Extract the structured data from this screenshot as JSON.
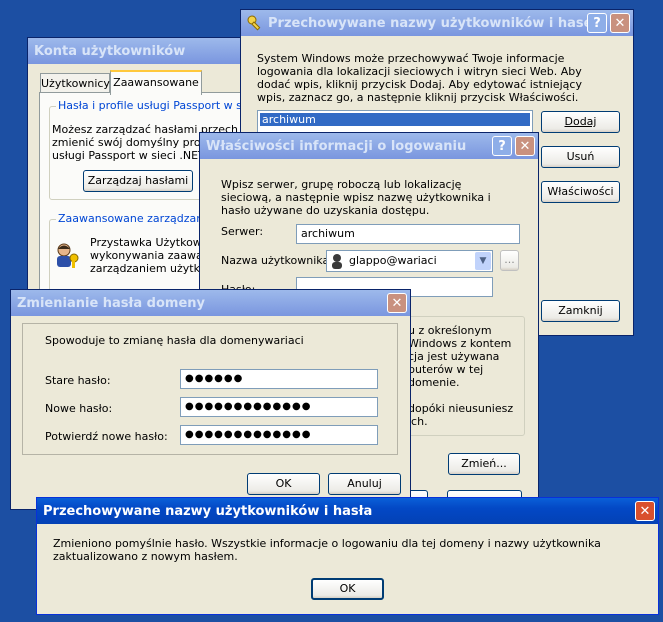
{
  "konta": {
    "title": "Konta użytkowników",
    "tabs": [
      "Użytkownicy",
      "Zaawansowane"
    ],
    "passport_group_title": "Hasła i profile usługi Passport w sieci .",
    "passport_text": [
      "Możesz zarządzać hasłami przech",
      "zmienić swój domyślny profil",
      "usługi Passport w sieci .NET."
    ],
    "manage_button": "Zarządzaj hasłami",
    "advanced_group_title": "Zaawansowane zarządzanie u",
    "advanced_text": [
      "Przystawka Użytkown",
      "wykonywania zaawa",
      "zarządzaniem użytk"
    ],
    "change_button": "Zmień...",
    "icon": "users-key-icon"
  },
  "stored": {
    "title": "Przechowywane nazwy użytkowników i haseł",
    "description": "System Windows może przechowywać Twoje informacje logowania dla lokalizacji sieciowych i witryn sieci Web. Aby dodać wpis, kliknij przycisk Dodaj. Aby edytować istniejący wpis, zaznacz go, a następnie kliknij przycisk Właściwości.",
    "entries": [
      "archiwum"
    ],
    "buttons": {
      "add": "Dodaj",
      "remove": "Usuń",
      "properties": "Właściwości",
      "close": "Zamknij"
    },
    "help": "?",
    "close_glyph": "✕",
    "icon": "key-icon"
  },
  "props": {
    "title": "Właściwości informacji o logowaniu",
    "description": "Wpisz serwer, grupę roboczą lub lokalizację sieciową, a następnie wpisz nazwę użytkownika i hasło używane do uzyskania dostępu.",
    "server_label": "Serwer:",
    "server_value": "archiwum",
    "user_label": "Nazwa użytkownika:",
    "user_value": "glappo@wariaci",
    "password_label": "Hasło:",
    "browse": "...",
    "info_fragments": [
      "u z określonym",
      "Windows z kontem",
      "cja jest używana",
      "puterów w tej domenie.",
      "",
      "dopóki nieusuniesz ich."
    ]
  },
  "change": {
    "title": "Zmienianie hasła domeny",
    "intro": "Spowoduje to zmianę hasła dla domenywariaci",
    "old_label": "Stare hasło:",
    "old_value": "●●●●●●",
    "new_label": "Nowe hasło:",
    "new_value": "●●●●●●●●●●●●●",
    "confirm_label": "Potwierdź nowe hasło:",
    "confirm_value": "●●●●●●●●●●●●●",
    "ok": "OK",
    "cancel": "Anuluj"
  },
  "message": {
    "title": "Przechowywane nazwy użytkowników i hasła",
    "text": "Zmieniono pomyślnie hasło. Wszystkie informacje o logowaniu dla tej domeny i nazwy użytkownika zaktualizowano z nowym hasłem.",
    "ok": "OK"
  }
}
